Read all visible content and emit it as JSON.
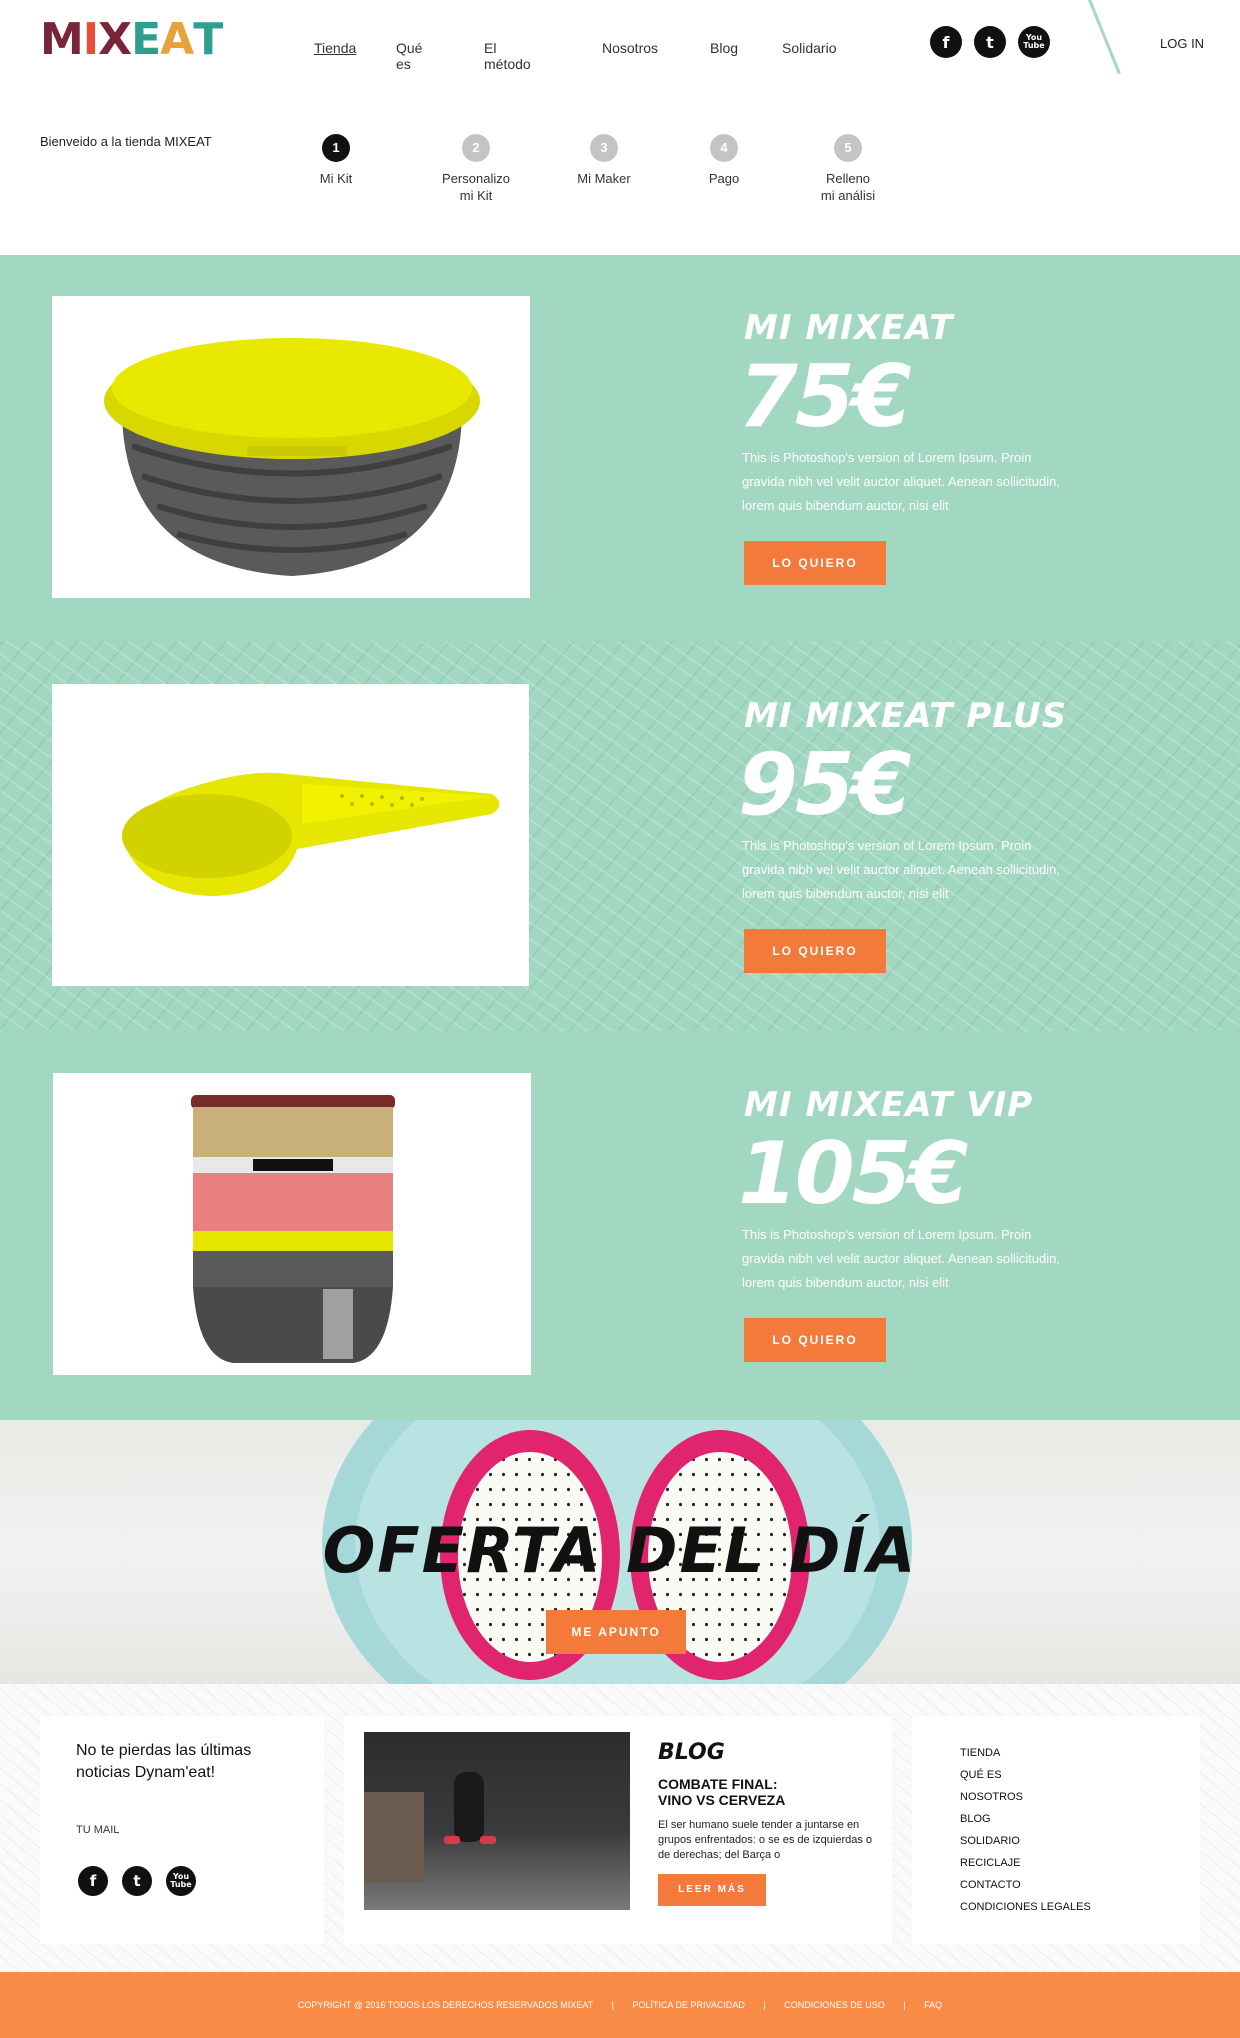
{
  "header": {
    "logo_letters": [
      "M",
      "I",
      "X",
      "E",
      "A",
      "T"
    ],
    "logo_colors": [
      "#7a2439",
      "#e94e3d",
      "#7a2439",
      "#2e9e8f",
      "#e9a23b",
      "#2e9e8f"
    ],
    "nav": [
      "Tienda",
      "Qué es",
      "El método",
      "Nosotros",
      "Blog",
      "Solidario"
    ],
    "social": [
      "facebook-icon",
      "twitter-icon",
      "youtube-icon"
    ],
    "social_glyphs": [
      "f",
      "t",
      "You\nTube"
    ],
    "login": "LOG IN"
  },
  "welcome": "Bienveido a la tienda MIXEAT",
  "steps": [
    {
      "num": "1",
      "label": "Mi Kit",
      "active": true
    },
    {
      "num": "2",
      "label": "Personalizo\nmi Kit",
      "active": false
    },
    {
      "num": "3",
      "label": "Mi Maker",
      "active": false
    },
    {
      "num": "4",
      "label": "Pago",
      "active": false
    },
    {
      "num": "5",
      "label": "Relleno\nmi análisi",
      "active": false
    }
  ],
  "products": [
    {
      "title": "MI MIXEAT",
      "price": "75€",
      "description": "This is Photoshop's version  of Lorem Ipsum. Proin gravida nibh vel velit auctor aliquet. Aenean sollicitudin, lorem quis bibendum auctor, nisi elit",
      "button": "LO QUIERO"
    },
    {
      "title": "MI MIXEAT PLUS",
      "price": "95€",
      "description": "This is Photoshop's version  of Lorem Ipsum. Proin gravida nibh vel velit auctor aliquet. Aenean sollicitudin, lorem quis bibendum auctor, nisi elit",
      "button": "LO QUIERO"
    },
    {
      "title": "MI MIXEAT VIP",
      "price": "105€",
      "description": "This is Photoshop's version  of Lorem Ipsum. Proin gravida nibh vel velit auctor aliquet. Aenean sollicitudin, lorem quis bibendum auctor, nisi elit",
      "button": "LO QUIERO"
    }
  ],
  "offer": {
    "title": "OFERTA DEL DÍA",
    "button": "ME APUNTO"
  },
  "footer": {
    "newsletter_title": "No te pierdas las últimas noticias Dynam'eat!",
    "mail_label": "TU MAIL",
    "blog_heading": "BLOG",
    "blog_subtitle_1": "COMBATE FINAL:",
    "blog_subtitle_2": "VINO VS CERVEZA",
    "blog_text": "El ser humano suele tender a juntarse en grupos enfrentados: o se es de izquierdas o de derechas; del Barça o",
    "blog_button": "LEER MÁS",
    "links": [
      "TIENDA",
      "QUÉ ES",
      "NOSOTROS",
      "BLOG",
      "SOLIDARIO",
      "RECICLAJE",
      "CONTACTO",
      "CONDICIONES LEGALES"
    ]
  },
  "copyright": {
    "text": "COPYRIGHT @ 2016 TODOS LOS DERECHOS RESERVADOS MIXEAT",
    "separator": "|",
    "privacy": "POLÍTICA DE PRIVACIDAD",
    "terms": "CONDICIONES DE USO",
    "faq": "FAQ"
  },
  "colors": {
    "mint": "#a2d8c1",
    "orange": "#f47a3c",
    "footer_orange": "#f98b46"
  }
}
